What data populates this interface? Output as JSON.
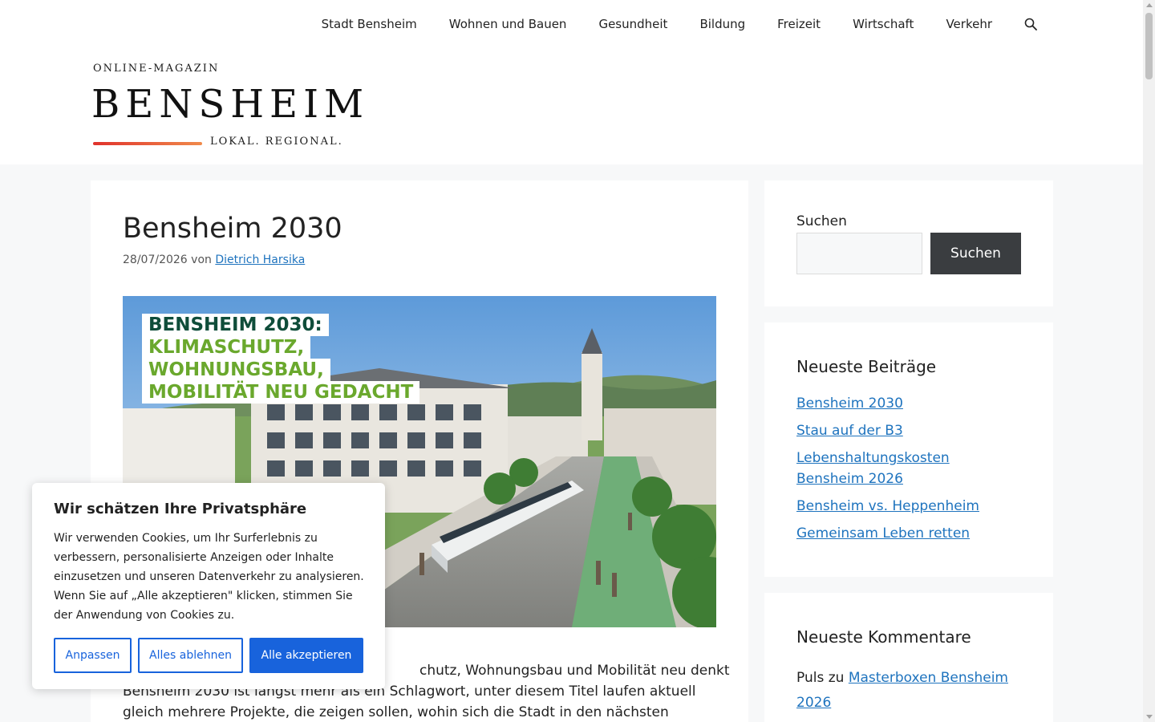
{
  "nav": {
    "items": [
      "Stadt Bensheim",
      "Wohnen und Bauen",
      "Gesundheit",
      "Bildung",
      "Freizeit",
      "Wirtschaft",
      "Verkehr"
    ],
    "search_icon": "search-icon"
  },
  "logo": {
    "top": "ONLINE-MAGAZIN",
    "main": "BENSHEIM",
    "sub": "LOKAL. REGIONAL."
  },
  "article": {
    "title": "Bensheim 2030",
    "date": "28/07/2026",
    "by": "von",
    "author": "Dietrich Harsika",
    "hero": {
      "line1": "BENSHEIM 2030:",
      "line2": "KLIMASCHUTZ,",
      "line3": "WOHNUNGSBAU,",
      "line4": "MOBILITÄT NEU GEDACHT"
    },
    "text_line1": "chutz, Wohnungsbau und Mobilität neu denkt",
    "text_line2": "Bensheim 2030 ist längst mehr als ein Schlagwort, unter diesem Titel laufen aktuell",
    "text_line3": "gleich mehrere Projekte, die zeigen sollen, wohin sich die Stadt in den nächsten"
  },
  "sidebar": {
    "search": {
      "label": "Suchen",
      "button": "Suchen",
      "placeholder": ""
    },
    "recent_posts": {
      "title": "Neueste Beiträge",
      "items": [
        "Bensheim 2030",
        "Stau auf der B3",
        "Lebenshaltungskosten Bensheim 2026",
        "Bensheim vs. Heppenheim",
        "Gemeinsam Leben retten"
      ]
    },
    "recent_comments": {
      "title": "Neueste Kommentare",
      "author": "Puls",
      "connector": "zu",
      "link": "Masterboxen Bensheim 2026"
    }
  },
  "cookie": {
    "title": "Wir schätzen Ihre Privatsphäre",
    "text": "Wir verwenden Cookies, um Ihr Surferlebnis zu verbessern, personalisierte Anzeigen oder Inhalte einzusetzen und unseren Datenverkehr zu analysieren. Wenn Sie auf „Alle akzeptieren\" klicken, stimmen Sie der Anwendung von Cookies zu.",
    "btn_customize": "Anpassen",
    "btn_reject": "Alles ablehnen",
    "btn_accept": "Alle akzeptieren"
  },
  "colors": {
    "link": "#1e73be",
    "cookie_accent": "#1863dc",
    "search_button": "#3a3d40",
    "hero_green": "#6aa82d",
    "hero_dark_green": "#0f4d3a"
  }
}
